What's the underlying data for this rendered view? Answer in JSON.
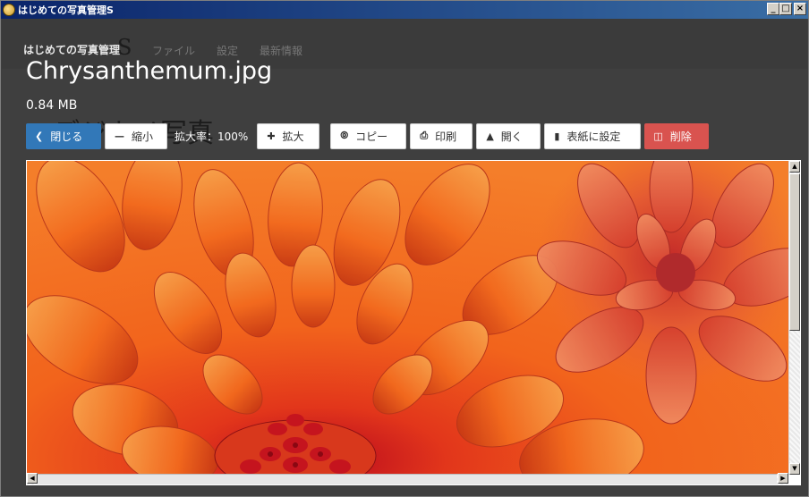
{
  "window": {
    "title": "はじめての写真管理S",
    "controls": [
      "_",
      "□",
      "×"
    ]
  },
  "nav": {
    "brand": "はじめての写真管理",
    "brand_ghost": "S",
    "menu": [
      "ファイル",
      "設定",
      "最新情報"
    ]
  },
  "page": {
    "ghost_heading": "デジカメ写真",
    "filename": "Chrysanthemum.jpg",
    "filesize": "0.84 MB"
  },
  "toolbar": {
    "close_label": "閉じる",
    "zoom_out_label": "縮小",
    "zoom_text": "拡大率：100%",
    "zoom_in_label": "拡大",
    "copy_label": "コピー",
    "print_label": "印刷",
    "open_label": "開く",
    "cover_label": "表紙に設定",
    "delete_label": "削除"
  },
  "icons": {
    "close": "chevron-left-icon",
    "zoom_out": "minus-icon",
    "zoom_in": "plus-icon",
    "copy": "copy-icon",
    "print": "print-icon",
    "open": "upload-icon",
    "cover": "bookmark-icon",
    "delete": "trash-icon"
  },
  "colors": {
    "primary": "#3278b8",
    "danger": "#d9534f",
    "background": "#3f3f3f",
    "flower": "#f05a1a"
  }
}
